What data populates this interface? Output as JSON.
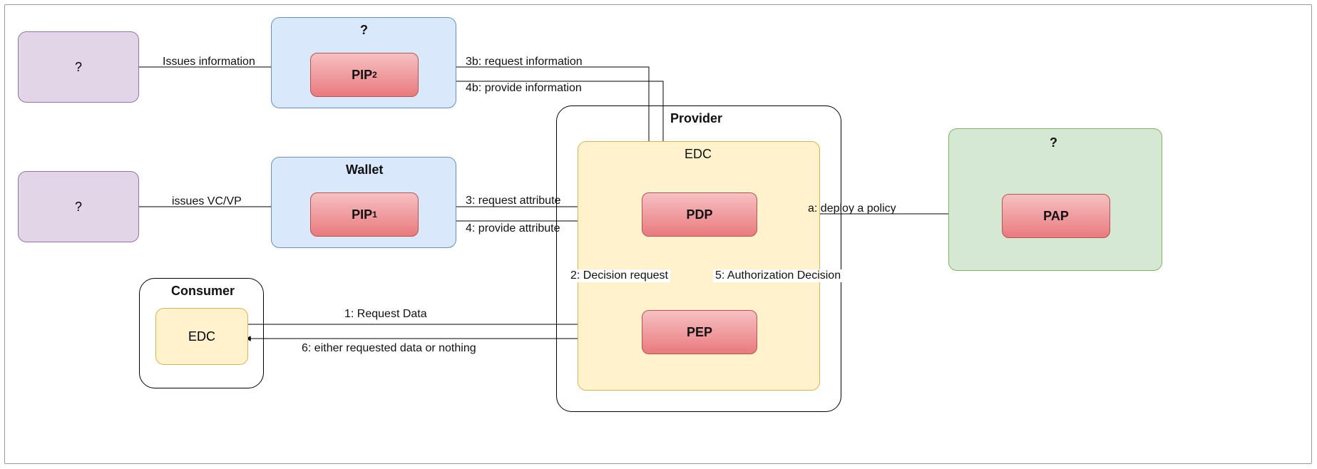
{
  "containers": {
    "top_blue_title": "?",
    "wallet_title": "Wallet",
    "consumer_title": "Consumer",
    "provider_title": "Provider",
    "edc_inner_title": "EDC",
    "green_title": "?"
  },
  "boxes": {
    "purple_top": "?",
    "purple_mid": "?",
    "consumer_edc": "EDC"
  },
  "modules": {
    "pip2_base": "PIP",
    "pip2_sub": "2",
    "pip1_base": "PIP",
    "pip1_sub": "1",
    "pdp": "PDP",
    "pep": "PEP",
    "pap": "PAP"
  },
  "edges": {
    "issues_info": "Issues information",
    "issues_vcvp": "issues VC/VP",
    "e1": "1: Request Data",
    "e2": "2: Decision request",
    "e3": "3: request attribute",
    "e3b": "3b: request information",
    "e4": "4: provide attribute",
    "e4b": "4b: provide information",
    "e5": "5: Authorization Decision",
    "e6": "6: either requested data or nothing",
    "ea": "a: deploy a policy"
  }
}
